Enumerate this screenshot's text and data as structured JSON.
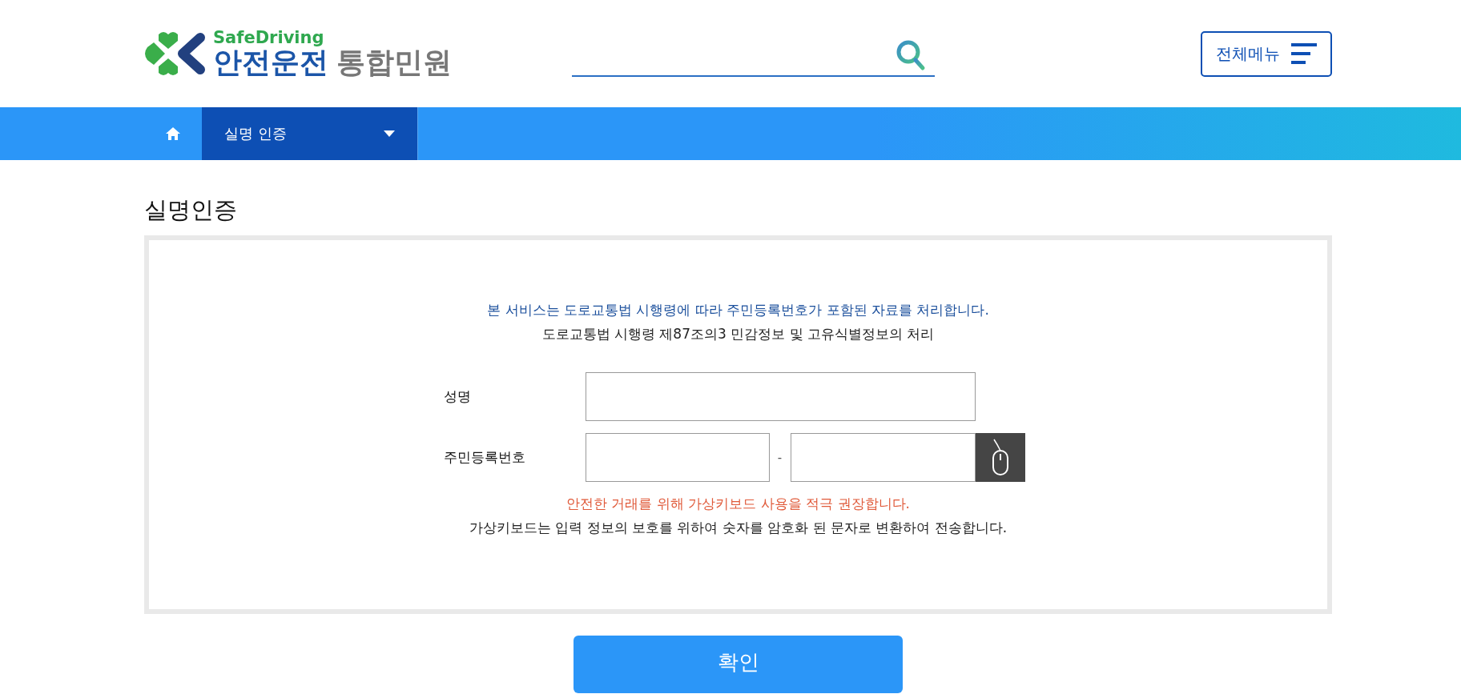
{
  "header": {
    "logo": {
      "subtitle": "SafeDriving",
      "name": "안전운전",
      "suffix": "통합민원"
    },
    "menu_button": "전체메뉴"
  },
  "nav": {
    "current": "실명 인증"
  },
  "page_title": "실명인증",
  "notice": {
    "primary": "본 서비스는 도로교통법 시행령에 따라 주민등록번호가 포함된 자료를 처리합니다.",
    "secondary": "도로교통법 시행령 제87조의3 민감정보 및 고유식별정보의 처리"
  },
  "fields": [
    {
      "label": "성명",
      "kind": "single"
    },
    {
      "label": "주민등록번호",
      "kind": "split",
      "separator": "-"
    }
  ],
  "warning": "안전한 거래를 위해 가상키보드 사용을 적극 권장합니다.",
  "info": "가상키보드는 입력 정보의 보호를 위하여 숫자를 암호화 된 문자로 변환하여 전송합니다.",
  "confirm_button": "확인"
}
